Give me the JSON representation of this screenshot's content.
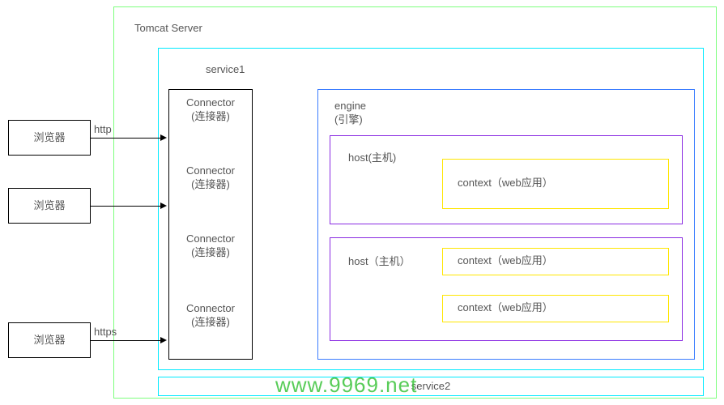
{
  "server": {
    "title": "Tomcat Server"
  },
  "service1": {
    "title": "service1",
    "connectors": [
      {
        "title": "Connector",
        "subtitle": "(连接器)"
      },
      {
        "title": "Connector",
        "subtitle": "(连接器)"
      },
      {
        "title": "Connector",
        "subtitle": "(连接器)"
      },
      {
        "title": "Connector",
        "subtitle": "(连接器)"
      }
    ]
  },
  "service2": {
    "title": "service2"
  },
  "engine": {
    "title": "engine",
    "subtitle": "(引擎)",
    "hosts": [
      {
        "title": "host(主机)",
        "contexts": [
          {
            "title": "context（web应用）"
          }
        ]
      },
      {
        "title": "host（主机）",
        "contexts": [
          {
            "title": "context（web应用）"
          },
          {
            "title": "context（web应用）"
          }
        ]
      }
    ]
  },
  "browsers": [
    {
      "label": "浏览器"
    },
    {
      "label": "浏览器"
    },
    {
      "label": "浏览器"
    }
  ],
  "edges": [
    {
      "label": "http"
    },
    {
      "label": ""
    },
    {
      "label": "https"
    }
  ],
  "watermark": "www.9969.net"
}
